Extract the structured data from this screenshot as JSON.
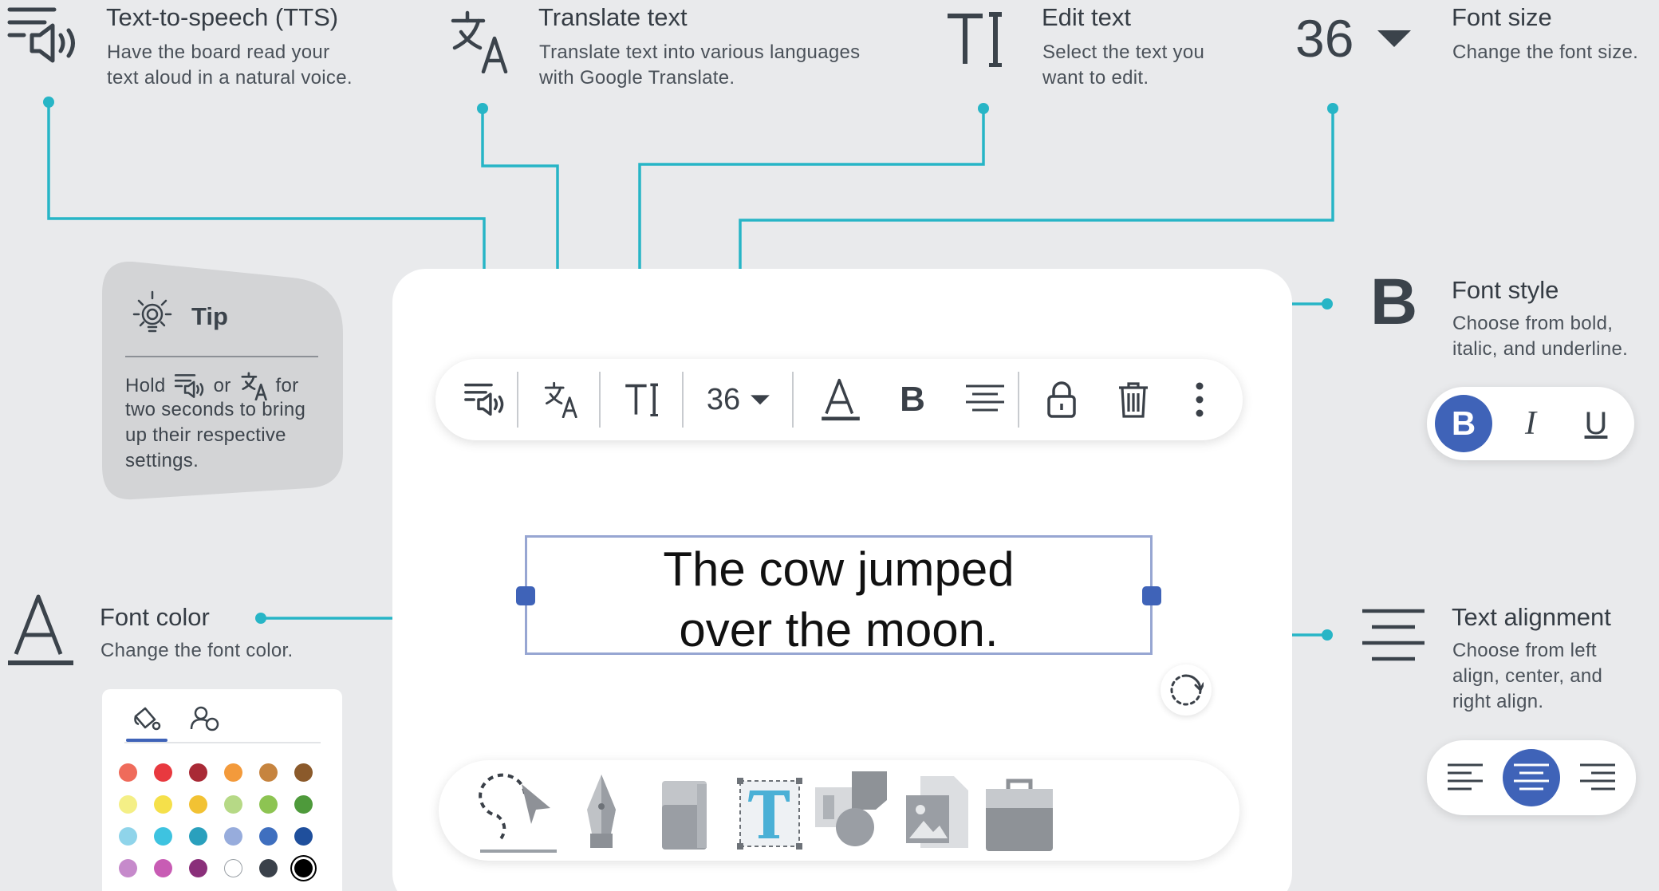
{
  "colors": {
    "background": "#e9eaec",
    "connector": "#27b5c6",
    "accent": "#3f63b8",
    "icon": "#3b434b"
  },
  "callouts": {
    "tts": {
      "icon": "tts-icon",
      "title": "Text-to-speech (TTS)",
      "desc_line1": "Have the board read your",
      "desc_line2": "text aloud in a natural voice."
    },
    "translate": {
      "icon": "translate-icon",
      "title": "Translate text",
      "desc_line1": "Translate text into various languages",
      "desc_line2": "with Google Translate."
    },
    "edit": {
      "icon": "edit-text-icon",
      "title": "Edit text",
      "desc_line1": "Select the text you",
      "desc_line2": "want to edit."
    },
    "font_size": {
      "value": "36",
      "title": "Font size",
      "desc_line1": "Change the font size."
    },
    "font_style": {
      "icon": "bold-icon",
      "title": "Font style",
      "desc_line1": "Choose from bold,",
      "desc_line2": "italic, and underline."
    },
    "font_color": {
      "icon": "font-color-icon",
      "title": "Font color",
      "desc_line1": "Change the font color."
    },
    "alignment": {
      "icon": "align-center-icon",
      "title": "Text alignment",
      "desc_line1": "Choose from left",
      "desc_line2": "align, center, and",
      "desc_line3": "right align."
    }
  },
  "tip": {
    "title": "Tip",
    "line1_a": "Hold",
    "line1_b": "or",
    "line1_c": "for",
    "line2": "two seconds to bring",
    "line3": "up their respective",
    "line4": "settings."
  },
  "toolbar": {
    "items": [
      "tts-icon",
      "translate-icon",
      "edit-text-icon",
      "font-size-select",
      "font-color-icon",
      "bold-icon",
      "align-center-icon",
      "lock-icon",
      "trash-icon",
      "more-vertical-icon"
    ],
    "font_size": "36",
    "bold_label": "B"
  },
  "textbox": {
    "line1": "The cow jumped",
    "line2": "over the moon."
  },
  "dock": {
    "tools": [
      "lasso-select-icon",
      "pen-icon",
      "eraser-icon",
      "text-tool-icon",
      "shapes-icon",
      "media-icon",
      "toolbox-icon"
    ],
    "active": "lasso-select-icon"
  },
  "color_panel": {
    "tabs": [
      "paint-bucket-icon",
      "palette-icon"
    ],
    "swatches": [
      [
        "#ef6b5b",
        "#e8393f",
        "#a92a36",
        "#f39a3b",
        "#c6843f",
        "#8b5a2b"
      ],
      [
        "#f4ef86",
        "#f5e04a",
        "#f2c233",
        "#b6d986",
        "#8dc452",
        "#4e9a3b"
      ],
      [
        "#8fd4ea",
        "#3ec3e0",
        "#2aa0bd",
        "#97acdc",
        "#3f6fbf",
        "#1f4f9c"
      ],
      [
        "#c68acb",
        "#c85cb4",
        "#8a2f7a",
        "#ffffff",
        "#3a414a",
        "#000000"
      ]
    ],
    "selected": "#000000"
  },
  "font_style_pill": {
    "bold": "B",
    "italic": "I",
    "underline": "U",
    "active": "bold"
  },
  "alignment_pill": {
    "options": [
      "align-left-icon",
      "align-center-icon",
      "align-right-icon"
    ],
    "active": "align-center-icon"
  }
}
